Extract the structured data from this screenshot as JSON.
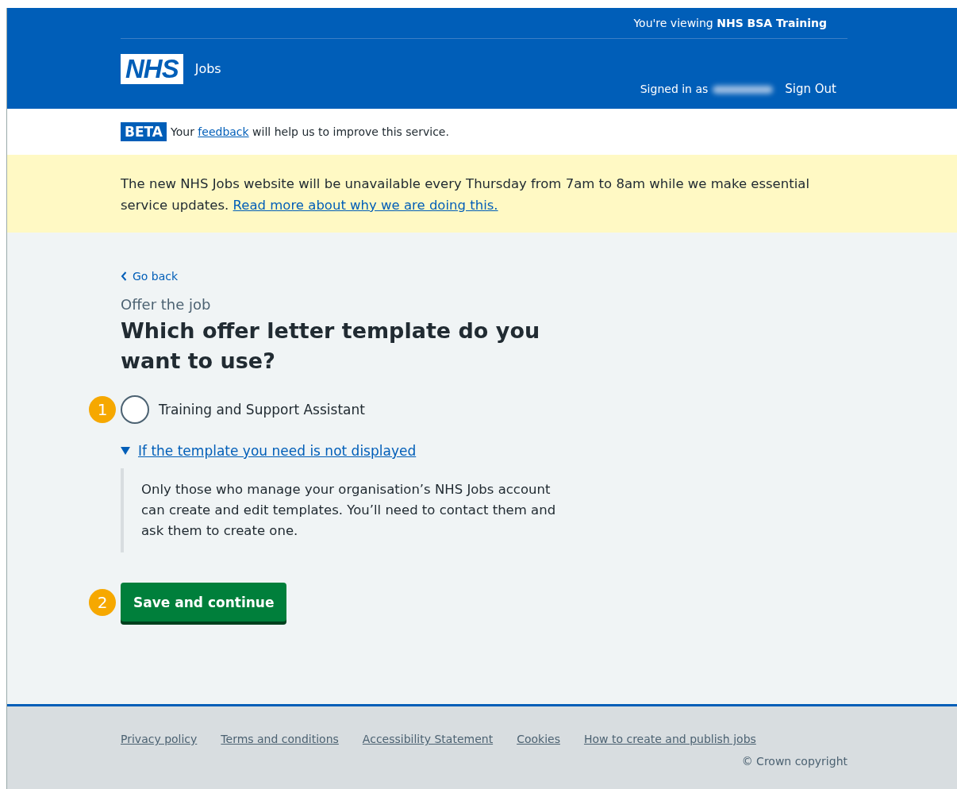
{
  "header": {
    "viewing_prefix": "You're viewing",
    "viewing_org": "NHS BSA Training",
    "logo": "NHS",
    "service": "Jobs",
    "signed_in_label": "Signed in as",
    "sign_out": "Sign Out"
  },
  "beta": {
    "tag": "BETA",
    "before": "Your",
    "link": "feedback",
    "after": "will help us to improve this service."
  },
  "notice": {
    "text": "The new NHS Jobs website will be unavailable every Thursday from 7am to 8am while we make essential service updates.",
    "link": "Read more about why we are doing this."
  },
  "back_link": "Go back",
  "caption": "Offer the job",
  "heading": "Which offer letter template do you want to use?",
  "options": [
    {
      "label": "Training and Support Assistant",
      "selected": false,
      "callout": "1"
    }
  ],
  "details": {
    "summary": "If the template you need is not displayed",
    "expanded": true,
    "text": "Only those who manage your organisation’s NHS Jobs account can create and edit templates. You’ll need to contact them and ask them to create one."
  },
  "button": {
    "label": "Save and continue",
    "callout": "2"
  },
  "footer": {
    "links": [
      "Privacy policy",
      "Terms and conditions",
      "Accessibility Statement",
      "Cookies",
      "How to create and publish jobs"
    ],
    "copyright": "© Crown copyright"
  }
}
